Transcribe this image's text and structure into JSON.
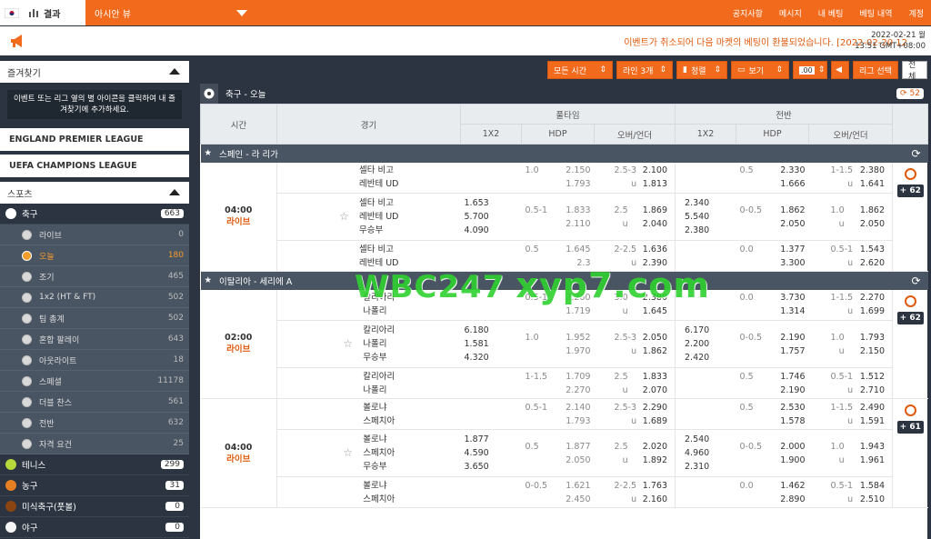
{
  "topbar": {
    "result_label": "결과",
    "view_label": "아시안 뷰",
    "nav": [
      "공지사항",
      "메시지",
      "내 베팅",
      "베팅 내역",
      "계정"
    ]
  },
  "notice": {
    "text": "이벤트가 취소되어 다음 마켓의 베팅이 환불되었습니다. [2022-02-20 12",
    "date": "2022-02-21 월",
    "time": "13:51 GMT+08:00"
  },
  "sidebar": {
    "favorites_title": "즐겨찾기",
    "favorites_msg": "이벤트 또는 리그 옆의 별 아이콘을 클릭하여 내 즐겨찾기에 추가하세요.",
    "leagues": [
      "ENGLAND PREMIER LEAGUE",
      "UEFA CHAMPIONS LEAGUE"
    ],
    "sports_title": "스포츠",
    "soccer": {
      "label": "축구",
      "count": "663"
    },
    "subs": [
      {
        "label": "라이브",
        "count": "0"
      },
      {
        "label": "오늘",
        "count": "180"
      },
      {
        "label": "조기",
        "count": "465"
      },
      {
        "label": "1x2 (HT & FT)",
        "count": "502"
      },
      {
        "label": "팀 총계",
        "count": "502"
      },
      {
        "label": "혼합 팔레이",
        "count": "643"
      },
      {
        "label": "아웃라이트",
        "count": "18"
      },
      {
        "label": "스페셜",
        "count": "11178"
      },
      {
        "label": "더블 찬스",
        "count": "561"
      },
      {
        "label": "전반",
        "count": "632"
      },
      {
        "label": "자격 요건",
        "count": "25"
      }
    ],
    "others": [
      {
        "label": "테니스",
        "count": "299",
        "color": "#b6d83a"
      },
      {
        "label": "농구",
        "count": "31",
        "color": "#e67e22"
      },
      {
        "label": "미식축구(풋볼)",
        "count": "0",
        "color": "#8b4513"
      },
      {
        "label": "야구",
        "count": "0",
        "color": "#f5f5f5"
      }
    ]
  },
  "toolbar": {
    "all_time": "모든 시간",
    "lines": "라인 3개",
    "sort": "정렬",
    "view": "보기",
    "odds": ".00",
    "league_select": "리그 선택",
    "all": "전체"
  },
  "main": {
    "title": "축구 - 오늘",
    "count": "52",
    "headers": {
      "time": "시간",
      "match": "경기",
      "fulltime": "풀타임",
      "firsthalf": "전반",
      "c1x2": "1X2",
      "hdp": "HDP",
      "ou": "오버/언더"
    },
    "leagues": [
      {
        "name": "스페인 - 라 리가",
        "time": "04:00",
        "status": "라이브",
        "more": "+ 62",
        "rows": [
          {
            "teams": [
              "셀타 비고",
              "레반테 UD"
            ],
            "x12": [],
            "hdp": [
              "1.0",
              ""
            ],
            "hdpo": [
              "2.150",
              "1.793"
            ],
            "ou": [
              "2.5-3",
              "u"
            ],
            "ouo": [
              "2.100",
              "1.813"
            ],
            "hx12": [],
            "hhdp": [
              "0.5",
              ""
            ],
            "hhdpo": [
              "2.330",
              "1.666"
            ],
            "hou": [
              "1-1.5",
              "u"
            ],
            "houo": [
              "2.380",
              "1.641"
            ]
          },
          {
            "teams": [
              "셀타 비고",
              "레반테 UD",
              "무승부"
            ],
            "x12": [
              "1.653",
              "5.700",
              "4.090"
            ],
            "hdp": [
              "0.5-1",
              ""
            ],
            "hdpo": [
              "1.833",
              "2.110"
            ],
            "ou": [
              "2.5",
              "u"
            ],
            "ouo": [
              "1.869",
              "2.040"
            ],
            "hx12": [
              "2.340",
              "5.540",
              "2.380"
            ],
            "hhdp": [
              "0-0.5",
              ""
            ],
            "hhdpo": [
              "1.862",
              "2.050"
            ],
            "hou": [
              "1.0",
              "u"
            ],
            "houo": [
              "1.862",
              "2.050"
            ]
          },
          {
            "teams": [
              "셀타 비고",
              "레반테 UD"
            ],
            "x12": [],
            "hdp": [
              "0.5",
              ""
            ],
            "hdpo": [
              "1.645",
              "2.3"
            ],
            "ou": [
              "2-2.5",
              "u"
            ],
            "ouo": [
              "1.636",
              "2.390"
            ],
            "hx12": [],
            "hhdp": [
              "0.0",
              ""
            ],
            "hhdpo": [
              "1.377",
              "3.300"
            ],
            "hou": [
              "0.5-1",
              "u"
            ],
            "houo": [
              "1.543",
              "2.620"
            ]
          }
        ]
      },
      {
        "name": "이탈리아 - 세리에 A",
        "time": "02:00",
        "status": "라이브",
        "more": "+ 62",
        "rows": [
          {
            "teams": [
              "칼리아리",
              "나폴리"
            ],
            "x12": [],
            "hdp": [
              "",
              "0.5-1"
            ],
            "hdpo": [
              "2.260",
              "1.719"
            ],
            "ou": [
              "3.0",
              "u"
            ],
            "ouo": [
              "2.380",
              "1.645"
            ],
            "hx12": [],
            "hhdp": [
              "0.0",
              ""
            ],
            "hhdpo": [
              "3.730",
              "1.314"
            ],
            "hou": [
              "1-1.5",
              "u"
            ],
            "houo": [
              "2.270",
              "1.699"
            ]
          },
          {
            "teams": [
              "칼리아리",
              "나폴리",
              "무승부"
            ],
            "x12": [
              "6.180",
              "1.581",
              "4.320"
            ],
            "hdp": [
              "",
              "1.0"
            ],
            "hdpo": [
              "1.952",
              "1.970"
            ],
            "ou": [
              "2.5-3",
              "u"
            ],
            "ouo": [
              "2.050",
              "1.862"
            ],
            "hx12": [
              "6.170",
              "2.200",
              "2.420"
            ],
            "hhdp": [
              "",
              "0-0.5"
            ],
            "hhdpo": [
              "2.190",
              "1.757"
            ],
            "hou": [
              "1.0",
              "u"
            ],
            "houo": [
              "1.793",
              "2.150"
            ]
          },
          {
            "teams": [
              "칼리아리",
              "나폴리"
            ],
            "x12": [],
            "hdp": [
              "",
              "1-1.5"
            ],
            "hdpo": [
              "1.709",
              "2.270"
            ],
            "ou": [
              "2.5",
              "u"
            ],
            "ouo": [
              "1.833",
              "2.070"
            ],
            "hx12": [],
            "hhdp": [
              "",
              "0.5"
            ],
            "hhdpo": [
              "1.746",
              "2.190"
            ],
            "hou": [
              "0.5-1",
              "u"
            ],
            "houo": [
              "1.512",
              "2.710"
            ]
          }
        ]
      },
      {
        "name": "",
        "time": "04:00",
        "status": "라이브",
        "more": "+ 61",
        "rows": [
          {
            "teams": [
              "볼로냐",
              "스페치아"
            ],
            "x12": [],
            "hdp": [
              "0.5-1",
              ""
            ],
            "hdpo": [
              "2.140",
              "1.793"
            ],
            "ou": [
              "2.5-3",
              "u"
            ],
            "ouo": [
              "2.290",
              "1.689"
            ],
            "hx12": [],
            "hhdp": [
              "0.5",
              ""
            ],
            "hhdpo": [
              "2.530",
              "1.578"
            ],
            "hou": [
              "1-1.5",
              "u"
            ],
            "houo": [
              "2.490",
              "1.591"
            ]
          },
          {
            "teams": [
              "볼로냐",
              "스페치아",
              "무승부"
            ],
            "x12": [
              "1.877",
              "4.590",
              "3.650"
            ],
            "hdp": [
              "0.5",
              ""
            ],
            "hdpo": [
              "1.877",
              "2.050"
            ],
            "ou": [
              "2.5",
              "u"
            ],
            "ouo": [
              "2.020",
              "1.892"
            ],
            "hx12": [
              "2.540",
              "4.960",
              "2.310"
            ],
            "hhdp": [
              "0-0.5",
              ""
            ],
            "hhdpo": [
              "2.000",
              "1.900"
            ],
            "hou": [
              "1.0",
              "u"
            ],
            "houo": [
              "1.943",
              "1.961"
            ]
          },
          {
            "teams": [
              "볼로냐",
              "스페치아"
            ],
            "x12": [],
            "hdp": [
              "0-0.5",
              ""
            ],
            "hdpo": [
              "1.621",
              "2.450"
            ],
            "ou": [
              "2-2.5",
              "u"
            ],
            "ouo": [
              "1.763",
              "2.160"
            ],
            "hx12": [],
            "hhdp": [
              "0.0",
              ""
            ],
            "hhdpo": [
              "1.462",
              "2.890"
            ],
            "hou": [
              "0.5-1",
              "u"
            ],
            "houo": [
              "1.584",
              "2.510"
            ]
          }
        ]
      }
    ]
  },
  "watermark": {
    "a": "WBC247",
    "b": "xyp7.com"
  }
}
